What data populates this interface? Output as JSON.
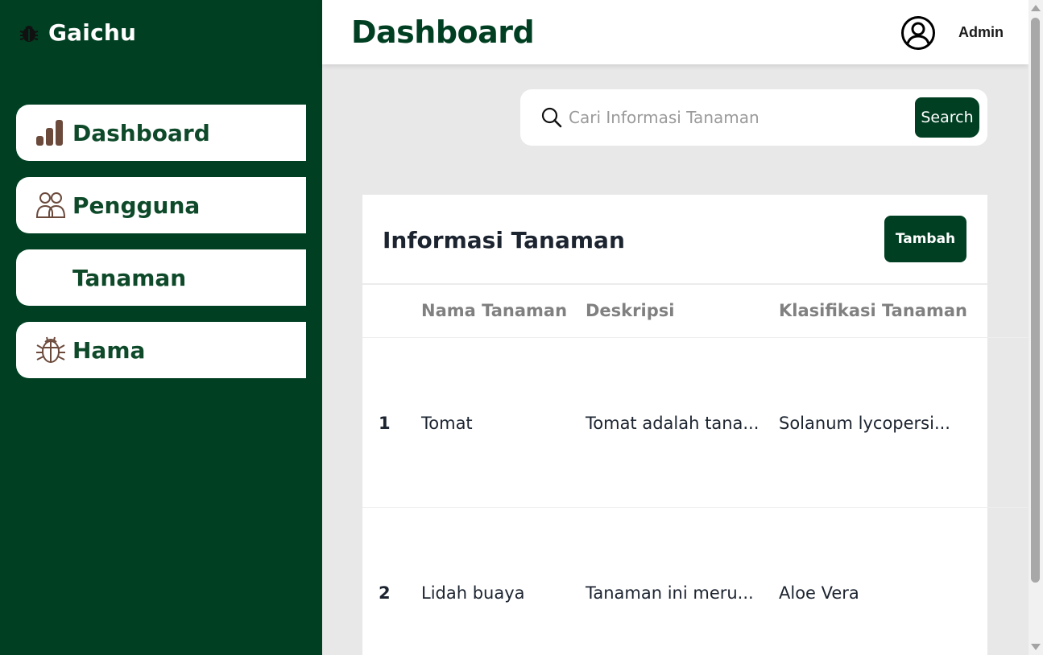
{
  "brand": {
    "name": "Gaichu",
    "icon": "bug-icon"
  },
  "sidebar": {
    "items": [
      {
        "label": "Dashboard",
        "icon": "bar-chart-icon"
      },
      {
        "label": "Pengguna",
        "icon": "users-icon"
      },
      {
        "label": "Tanaman",
        "icon": ""
      },
      {
        "label": "Hama",
        "icon": "bug-icon"
      }
    ]
  },
  "header": {
    "title": "Dashboard",
    "user": "Admin",
    "user_icon": "user-circle-icon"
  },
  "search": {
    "placeholder": "Cari Informasi Tanaman",
    "value": "",
    "button": "Search"
  },
  "card": {
    "title": "Informasi Tanaman",
    "add_button": "Tambah",
    "columns": [
      "",
      "Nama Tanaman",
      "Deskripsi",
      "Klasifikasi Tanaman"
    ],
    "rows": [
      {
        "no": "1",
        "name": "Tomat",
        "description": "Tomat adalah tana...",
        "classification": "Solanum lycopersi..."
      },
      {
        "no": "2",
        "name": "Lidah buaya",
        "description": "Tanaman ini meru...",
        "classification": "Aloe Vera"
      }
    ]
  },
  "colors": {
    "primary": "#003f22",
    "icon_brown": "#6b4a3c",
    "background": "#e8e8e8",
    "card": "#ffffff"
  }
}
